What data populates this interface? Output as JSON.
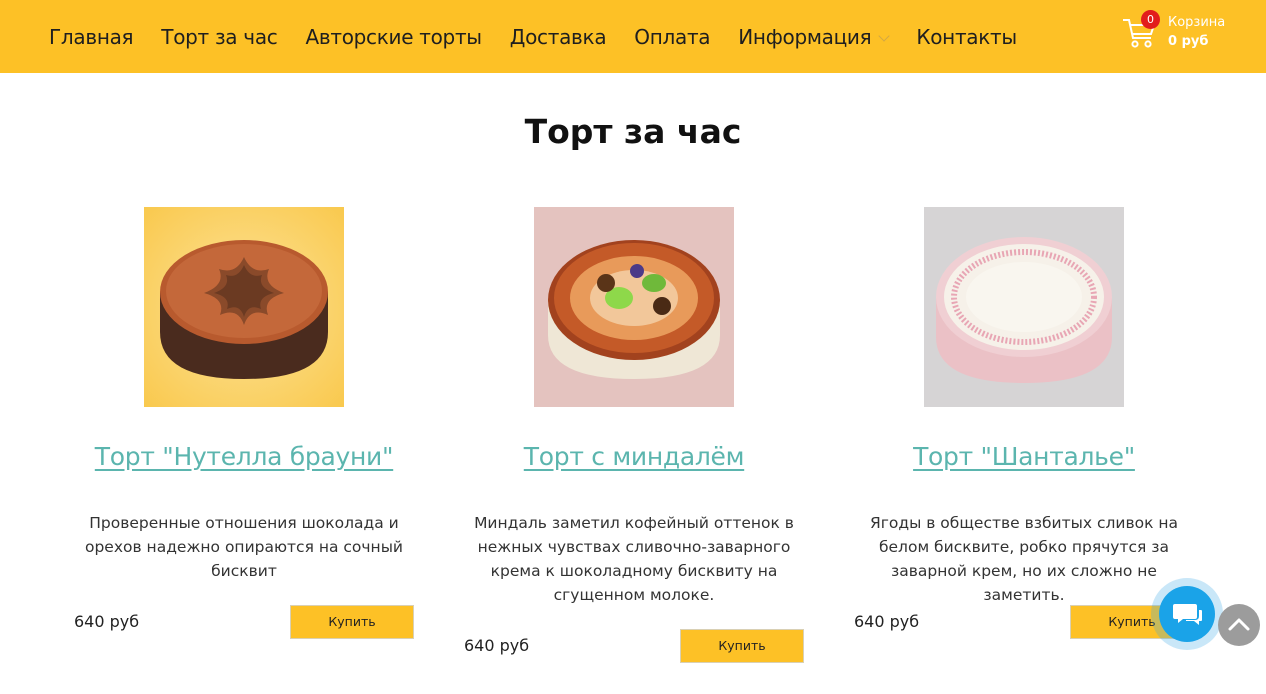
{
  "nav": {
    "items": [
      {
        "label": "Главная"
      },
      {
        "label": "Торт за час"
      },
      {
        "label": "Авторские торты"
      },
      {
        "label": "Доставка"
      },
      {
        "label": "Оплата"
      },
      {
        "label": "Информация",
        "has_dropdown": true
      },
      {
        "label": "Контакты"
      }
    ]
  },
  "cart": {
    "count": "0",
    "label": "Корзина",
    "total": "0 руб",
    "icon": "shopping-cart-icon"
  },
  "page": {
    "title": "Торт за час"
  },
  "products": [
    {
      "title": "Торт \"Нутелла брауни\"",
      "description": "Проверенные отношения шоколада и орехов надежно опираются на сочный бисквит",
      "price": "640 руб",
      "buy_label": "Купить"
    },
    {
      "title": "Торт с миндалём",
      "description": "Миндаль заметил кофейный оттенок в нежных чувствах сливочно-заварного крема к шоколадному бисквиту на сгущенном молоке.",
      "price": "640 руб",
      "buy_label": "Купить"
    },
    {
      "title": "Торт \"Шантальe\"",
      "description": "Ягоды в обществе взбитых сливок на белом бисквите, робко прячутся за заварной крем, но их сложно не заметить.",
      "price": "640 руб",
      "buy_label": "Купить"
    }
  ],
  "widgets": {
    "chat_icon": "chat-bubbles-icon",
    "scroll_up_icon": "chevron-up-icon"
  },
  "colors": {
    "header_bg": "#fdc126",
    "link": "#5bb5ae",
    "button": "#fdc126",
    "chat": "#1aa3e8",
    "badge": "#e21c1c"
  }
}
